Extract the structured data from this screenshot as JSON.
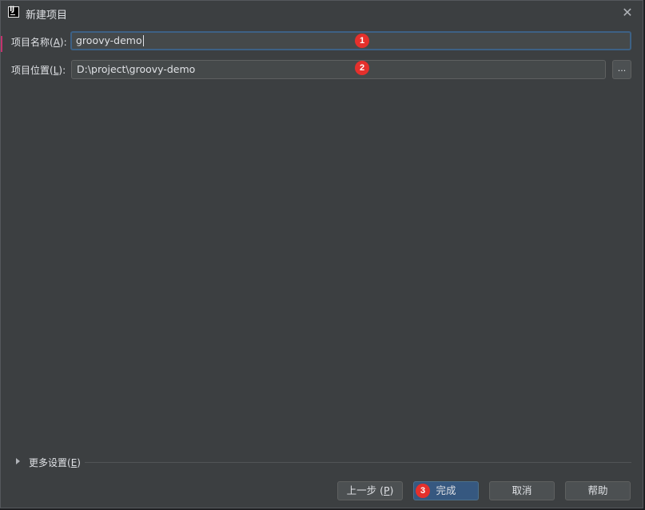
{
  "window": {
    "title": "新建项目",
    "close_glyph": "✕",
    "logo_text": "IJ"
  },
  "form": {
    "name_label": "项目名称",
    "name_mnemonic": "A",
    "name_value": "groovy-demo",
    "location_label": "项目位置",
    "location_mnemonic": "L",
    "location_value": "D:\\project\\groovy-demo",
    "browse_label": "..."
  },
  "more_settings": {
    "label": "更多设置",
    "mnemonic": "E"
  },
  "buttons": {
    "previous_label": "上一步",
    "previous_mnemonic": "P",
    "finish_label": "完成",
    "cancel_label": "取消",
    "help_label": "帮助"
  },
  "annotations": {
    "badge_1": "1",
    "badge_2": "2",
    "badge_3": "3",
    "badge_color": "#e5302c"
  },
  "colors": {
    "dialog_bg": "#3c3f41",
    "input_bg": "#45494a",
    "focus_border": "#3d6185",
    "primary_button": "#365880"
  }
}
